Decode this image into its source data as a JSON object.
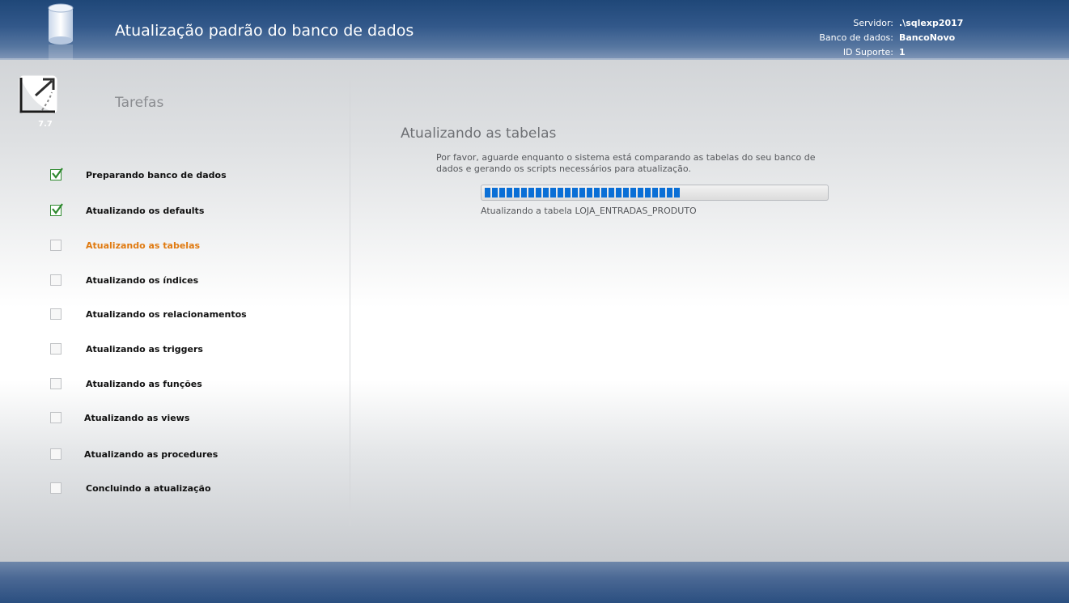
{
  "header": {
    "title": "Atualização padrão do banco de dados",
    "server_label": "Servidor:",
    "server_value": ".\\sqlexp2017",
    "database_label": "Banco de dados:",
    "database_value": "BancoNovo",
    "support_label": "ID Suporte:",
    "support_value": "1"
  },
  "sidebar": {
    "version": "7.7",
    "title": "Tarefas",
    "tasks": [
      {
        "label": "Preparando banco de dados",
        "status": "done"
      },
      {
        "label": "Atualizando os defaults",
        "status": "done"
      },
      {
        "label": "Atualizando as tabelas",
        "status": "active"
      },
      {
        "label": "Atualizando os índices",
        "status": "pending"
      },
      {
        "label": "Atualizando os relacionamentos",
        "status": "pending"
      },
      {
        "label": "Atualizando as triggers",
        "status": "pending"
      },
      {
        "label": "Atualizando as funções",
        "status": "pending"
      },
      {
        "label": "Atualizando as views",
        "status": "pending"
      },
      {
        "label": "Atualizando as procedures",
        "status": "pending"
      },
      {
        "label": "Concluindo a atualização",
        "status": "pending"
      }
    ]
  },
  "main": {
    "title": "Atualizando as tabelas",
    "description": "Por favor, aguarde enquanto o sistema está comparando as tabelas do seu banco de dados e gerando os scripts necessários para atualização.",
    "progress_fraction": 0.57,
    "status": "Atualizando a tabela LOJA_ENTRADAS_PRODUTO"
  },
  "colors": {
    "header_blue": "#2b4f80",
    "progress_blue": "#0a6fd6",
    "active_orange": "#e07a10",
    "check_green": "#2f8a2f"
  }
}
